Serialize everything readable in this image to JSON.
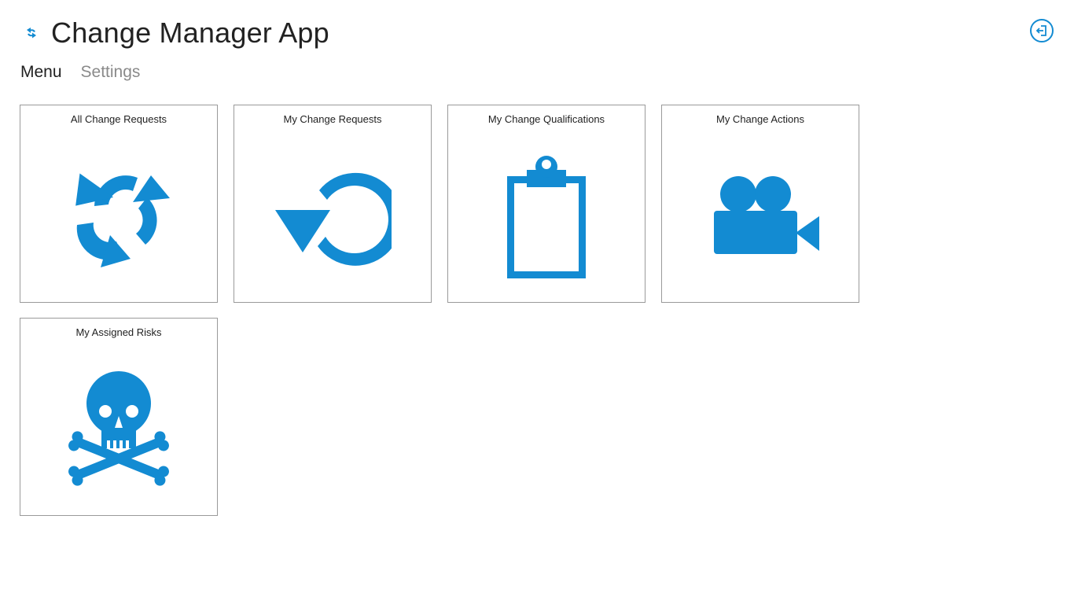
{
  "app": {
    "title": "Change Manager App",
    "logo_icon": "refresh-logo-icon",
    "exit_icon": "sign-out-icon",
    "accent_color": "#138bd2"
  },
  "nav": {
    "items": [
      {
        "label": "Menu",
        "active": true
      },
      {
        "label": "Settings",
        "active": false
      }
    ]
  },
  "tiles": [
    {
      "label": "All Change Requests",
      "icon": "recycle-arrows-icon"
    },
    {
      "label": "My Change Requests",
      "icon": "undo-circular-arrow-icon"
    },
    {
      "label": "My Change Qualifications",
      "icon": "clipboard-icon"
    },
    {
      "label": "My Change Actions",
      "icon": "video-camera-icon"
    },
    {
      "label": "My Assigned Risks",
      "icon": "skull-crossbones-icon"
    }
  ]
}
